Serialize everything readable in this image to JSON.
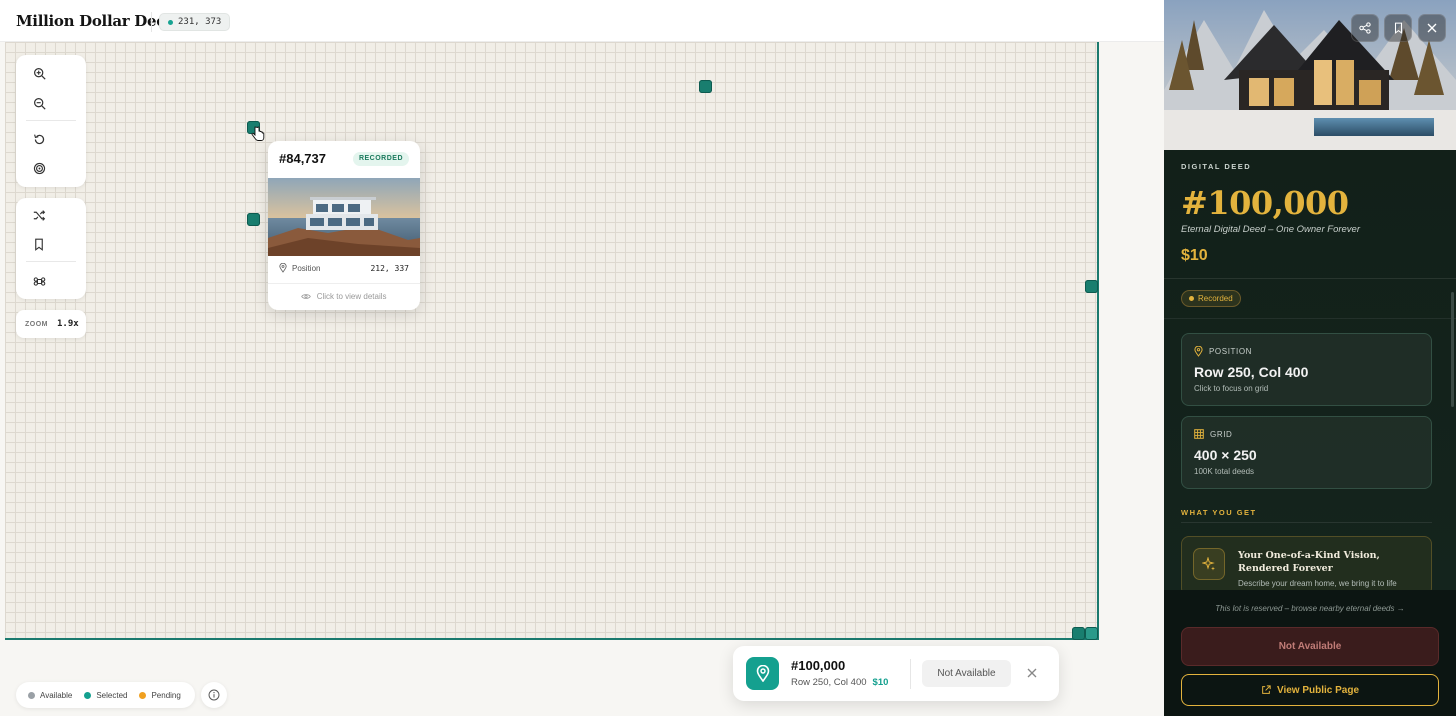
{
  "header": {
    "brand": "Million Dollar Deeds",
    "coords": "231, 373"
  },
  "grid": {
    "zoom_label": "ZOOM",
    "zoom_value": "1.9x"
  },
  "toolbar": {
    "tools": [
      "zoom-in-icon",
      "zoom-out-icon",
      "reset-icon",
      "target-icon",
      "shuffle-icon",
      "bookmark-icon",
      "command-icon"
    ]
  },
  "popup": {
    "id": "#84,737",
    "badge": "RECORDED",
    "position_label": "Position",
    "position_value": "212, 337",
    "footer": "Click to view details"
  },
  "legend": {
    "items": [
      {
        "label": "Available",
        "color": "#9aa0a6"
      },
      {
        "label": "Selected",
        "color": "#14a08f"
      },
      {
        "label": "Pending",
        "color": "#f0a020"
      }
    ]
  },
  "selection": {
    "title": "#100,000",
    "sub": "Row 250, Col 400",
    "price": "$10",
    "status": "Not Available"
  },
  "panel": {
    "eyebrow": "DIGITAL DEED",
    "title": "#100,000",
    "subtitle": "Eternal Digital Deed – One Owner Forever",
    "price": "$10",
    "status": "Recorded",
    "position_label": "POSITION",
    "position_value": "Row 250, Col 400",
    "position_sub": "Click to focus on grid",
    "grid_label": "GRID",
    "grid_value": "400 × 250",
    "grid_sub": "100K total deeds",
    "section_title": "WHAT YOU GET",
    "vision_title": "Your One-of-a-Kind Vision, Rendered Forever",
    "vision_sub": "Describe your dream home, we bring it to life",
    "reserved_note": "This lot is reserved – browse nearby eternal deeds →",
    "not_available": "Not Available",
    "view_public": "View Public Page"
  },
  "colors": {
    "accent_teal": "#14a08f",
    "gold": "#e3b33d",
    "panel_bg": "#0f1a16"
  }
}
